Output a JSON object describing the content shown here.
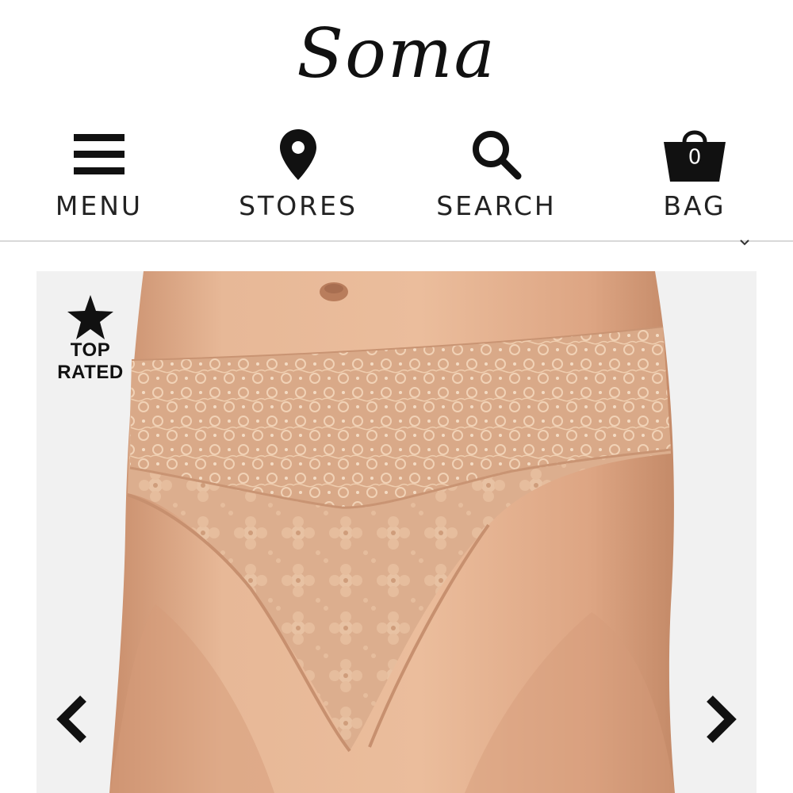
{
  "brand": {
    "logo_text": "Soma"
  },
  "nav": {
    "menu_label": "MENU",
    "stores_label": "STORES",
    "search_label": "SEARCH",
    "bag_label": "BAG",
    "bag_count": "0"
  },
  "product": {
    "badge_line1": "TOP",
    "badge_line2": "RATED",
    "image_icon": "lace-panty-photo",
    "prev_icon": "chevron-left-icon",
    "next_icon": "chevron-right-icon"
  },
  "colors": {
    "text": "#111111",
    "divider": "#d9d9d9",
    "skin": "#e3b393",
    "lace": "#dcae8c"
  }
}
